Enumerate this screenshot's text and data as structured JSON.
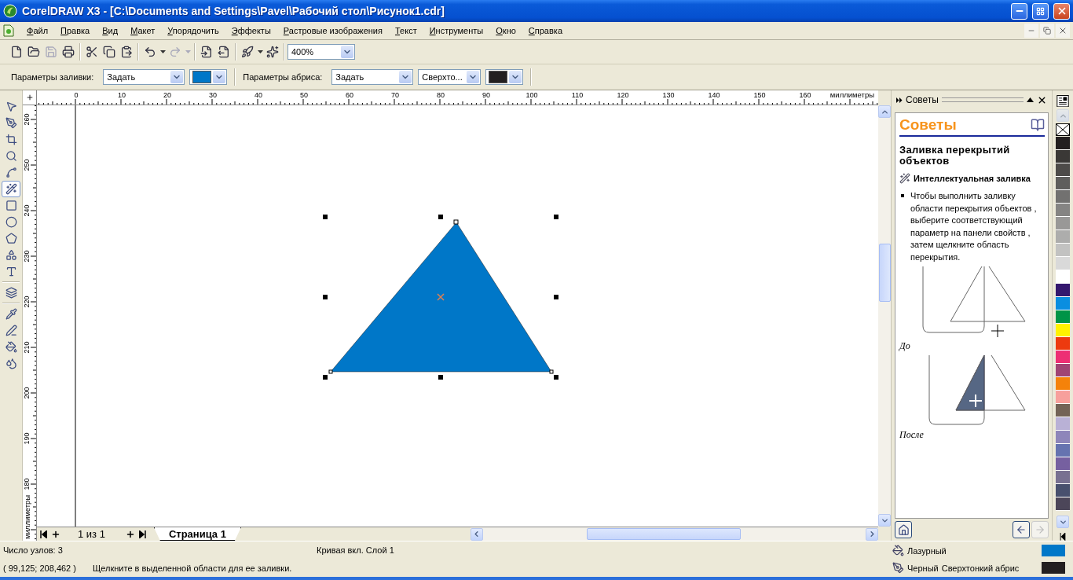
{
  "window": {
    "title": "CorelDRAW X3 - [C:\\Documents and Settings\\Pavel\\Рабочий стол\\Рисунок1.cdr]"
  },
  "menu": [
    "Файл",
    "Правка",
    "Вид",
    "Макет",
    "Упорядочить",
    "Эффекты",
    "Растровые изображения",
    "Текст",
    "Инструменты",
    "Окно",
    "Справка"
  ],
  "toolbar": {
    "groups": [
      [
        {
          "kind": "new",
          "disabled": false
        },
        {
          "kind": "open",
          "disabled": false
        },
        {
          "kind": "save",
          "disabled": true
        },
        {
          "kind": "print",
          "disabled": false
        }
      ],
      [
        {
          "kind": "cut",
          "disabled": false
        },
        {
          "kind": "copy",
          "disabled": false
        },
        {
          "kind": "paste",
          "disabled": false
        }
      ],
      [
        {
          "kind": "undo",
          "disabled": false
        },
        {
          "kind": "menu_arrow",
          "disabled": false
        },
        {
          "kind": "redo",
          "disabled": true
        },
        {
          "kind": "menu_arrow",
          "disabled": true
        }
      ],
      [
        {
          "kind": "import",
          "disabled": false
        },
        {
          "kind": "export",
          "disabled": false
        }
      ],
      [
        {
          "kind": "launcher",
          "disabled": false
        },
        {
          "kind": "menu_arrow",
          "disabled": false
        },
        {
          "kind": "welcome",
          "disabled": false
        }
      ]
    ],
    "zoom": "400%"
  },
  "property_bar": {
    "fill": {
      "label": "Параметры заливки:",
      "type": "Задать",
      "color": "#0077c8"
    },
    "outline": {
      "label": "Параметры абриса:",
      "type": "Задать",
      "width": "Сверхто...",
      "color": "#231f20"
    }
  },
  "toolbox": {
    "groups": [
      [
        {
          "kind": "pick",
          "selected": false
        },
        {
          "kind": "shape",
          "selected": false
        },
        {
          "kind": "crop",
          "selected": false
        },
        {
          "kind": "zoom",
          "selected": false
        },
        {
          "kind": "curve",
          "selected": false
        },
        {
          "kind": "smart_fill",
          "selected": true
        },
        {
          "kind": "rectangle",
          "selected": false
        },
        {
          "kind": "ellipse",
          "selected": false
        },
        {
          "kind": "polygon",
          "selected": false
        },
        {
          "kind": "shapes",
          "selected": false
        },
        {
          "kind": "text",
          "selected": false
        }
      ],
      [
        {
          "kind": "interactive",
          "selected": false
        }
      ],
      [
        {
          "kind": "eyedropper",
          "selected": false
        },
        {
          "kind": "outline",
          "selected": false
        },
        {
          "kind": "fill",
          "selected": false
        },
        {
          "kind": "interactive_fill",
          "selected": false
        }
      ]
    ]
  },
  "rulers": {
    "horizontal": {
      "labels": [
        "0",
        "10",
        "20",
        "30",
        "40",
        "50",
        "60",
        "70",
        "80",
        "90",
        "100",
        "110",
        "120",
        "130",
        "140",
        "150",
        "160"
      ],
      "unit": "миллиметры"
    },
    "vertical": {
      "labels": [
        "260",
        "250",
        "240",
        "230",
        "220",
        "210",
        "200",
        "190",
        "180"
      ],
      "unit": "миллиметры"
    }
  },
  "canvas": {
    "shapes": [
      {
        "kind": "triangle",
        "selected": true
      }
    ]
  },
  "page_nav": {
    "count": "1 из 1",
    "tabs": [
      {
        "label": "Страница 1",
        "selected": true
      }
    ]
  },
  "docker": {
    "title": "Советы",
    "heading": "Советы",
    "topic": "Заливка перекрытий объектов",
    "tool": "Интеллектуальная заливка",
    "bullets": [
      "Чтобы выполнить заливку области перекрытия объектов , выберите соответствующий параметр на панели свойств , затем щелкните область перекрытия."
    ],
    "figures": [
      {
        "kind": "before",
        "caption": "До"
      },
      {
        "kind": "after",
        "caption": "После"
      }
    ],
    "nav": {
      "back_disabled": false,
      "forward_disabled": true
    }
  },
  "palette": {
    "swatches": [
      {
        "color": "#231f20"
      },
      {
        "color": "#3a3836"
      },
      {
        "color": "#4d4b49"
      },
      {
        "color": "#5f5e5c"
      },
      {
        "color": "#727170"
      },
      {
        "color": "#858483"
      },
      {
        "color": "#999897"
      },
      {
        "color": "#adadac"
      },
      {
        "color": "#c2c2c1"
      },
      {
        "color": "#d9d9d9"
      },
      {
        "color": "#ffffff"
      },
      {
        "color": "#34176e"
      },
      {
        "color": "#0a8ee0"
      },
      {
        "color": "#009447"
      },
      {
        "color": "#fff200"
      },
      {
        "color": "#ed3a0f"
      },
      {
        "color": "#ed2f74"
      },
      {
        "color": "#a04474"
      },
      {
        "color": "#f5820a"
      },
      {
        "color": "#f7a09c"
      },
      {
        "color": "#736357"
      },
      {
        "color": "#b9b1d6"
      },
      {
        "color": "#8e86ba"
      },
      {
        "color": "#6673b0"
      },
      {
        "color": "#7660a0"
      },
      {
        "color": "#787191"
      },
      {
        "color": "#48506e"
      },
      {
        "color": "#4c4659"
      }
    ]
  },
  "status_bar": {
    "nodes": "Число узлов: 3",
    "object": "Кривая вкл. Слой 1",
    "coords": "( 99,125; 208,462 )",
    "hint": "Щелкните в выделенной области для ее заливки.",
    "styles": [
      {
        "kind": "fill",
        "name": "Лазурный",
        "color": "#0077c8"
      },
      {
        "kind": "outline",
        "name": "Черный",
        "detail": "Сверхтонкий абрис",
        "color": "#231f20"
      }
    ]
  }
}
